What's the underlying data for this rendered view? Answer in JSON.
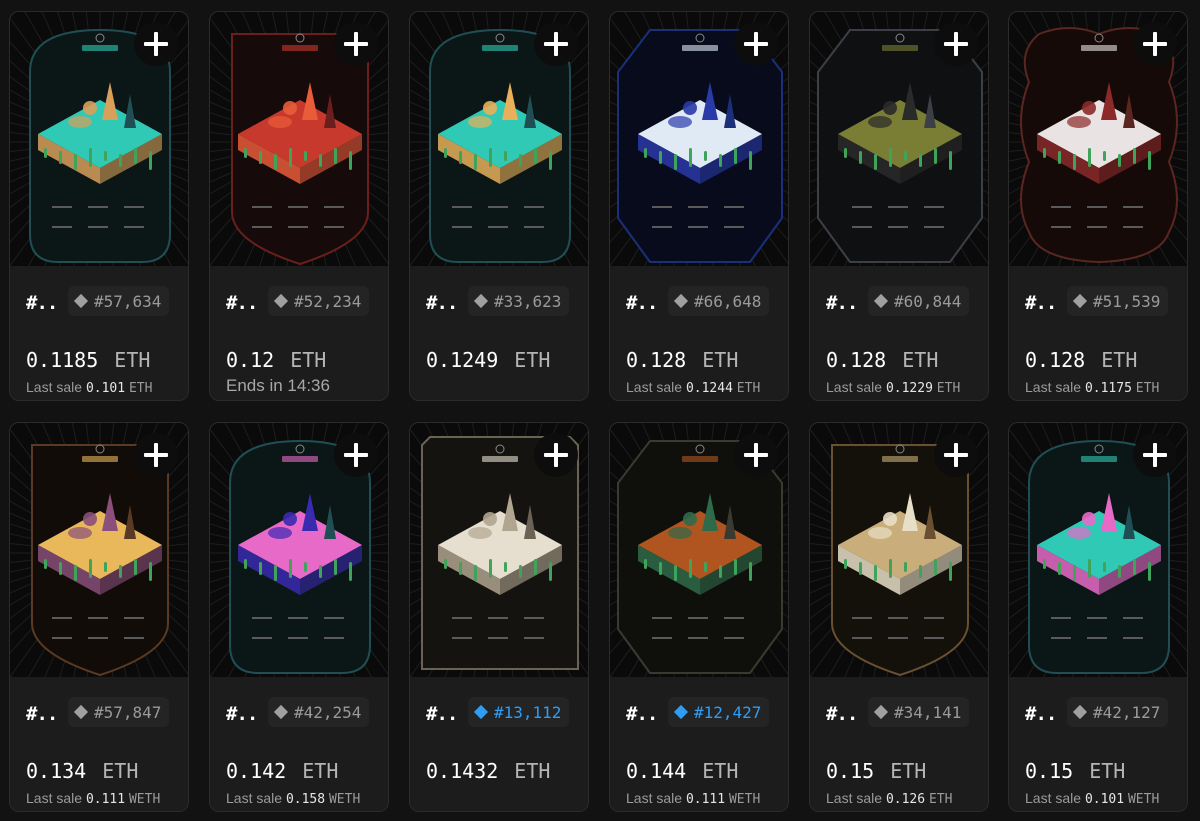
{
  "cards": [
    {
      "name": "#..",
      "rank": "#57,634",
      "rank_style": "common",
      "price": "0.1185",
      "currency": "ETH",
      "sub_label": "Last sale",
      "sub_value": "0.101",
      "sub_unit": "ETH",
      "frame_color": "#1f4f55",
      "bg_color": "#0b1616",
      "ground_color": "#2fc9b6",
      "accent_color": "#d9a05a",
      "frame": "round"
    },
    {
      "name": "#..",
      "rank": "#52,234",
      "rank_style": "common",
      "price": "0.12",
      "currency": "ETH",
      "sub_label": "Ends in 14:36",
      "sub_value": "",
      "sub_unit": "",
      "frame_color": "#6b1f1c",
      "bg_color": "#170a0a",
      "ground_color": "#c8392d",
      "accent_color": "#e85c3a",
      "frame": "shield"
    },
    {
      "name": "#..",
      "rank": "#33,623",
      "rank_style": "common",
      "price": "0.1249",
      "currency": "ETH",
      "sub_label": "",
      "sub_value": "",
      "sub_unit": "",
      "frame_color": "#1f4f55",
      "bg_color": "#0b1616",
      "ground_color": "#2fc9b6",
      "accent_color": "#e8b05a",
      "frame": "round"
    },
    {
      "name": "#..",
      "rank": "#66,648",
      "rank_style": "common",
      "price": "0.128",
      "currency": "ETH",
      "sub_label": "Last sale",
      "sub_value": "0.1244",
      "sub_unit": "ETH",
      "frame_color": "#1b2f7a",
      "bg_color": "#070b1c",
      "ground_color": "#dfeaf5",
      "accent_color": "#2a3aa8",
      "frame": "hex"
    },
    {
      "name": "#..",
      "rank": "#60,844",
      "rank_style": "common",
      "price": "0.128",
      "currency": "ETH",
      "sub_label": "Last sale",
      "sub_value": "0.1229",
      "sub_unit": "ETH",
      "frame_color": "#3c3f45",
      "bg_color": "#0f1012",
      "ground_color": "#7a7e35",
      "accent_color": "#2a2a2a",
      "frame": "hex"
    },
    {
      "name": "#..",
      "rank": "#51,539",
      "rank_style": "common",
      "price": "0.128",
      "currency": "ETH",
      "sub_label": "Last sale",
      "sub_value": "0.1175",
      "sub_unit": "ETH",
      "frame_color": "#5a2620",
      "bg_color": "#160a08",
      "ground_color": "#e9e3e3",
      "accent_color": "#8c2a2a",
      "frame": "wavy"
    },
    {
      "name": "#..",
      "rank": "#57,847",
      "rank_style": "common",
      "price": "0.134",
      "currency": "ETH",
      "sub_label": "Last sale",
      "sub_value": "0.111",
      "sub_unit": "WETH",
      "frame_color": "#5a3a22",
      "bg_color": "#120c08",
      "ground_color": "#e8b85a",
      "accent_color": "#8a4f7a",
      "frame": "shield"
    },
    {
      "name": "#..",
      "rank": "#42,254",
      "rank_style": "common",
      "price": "0.142",
      "currency": "ETH",
      "sub_label": "Last sale",
      "sub_value": "0.158",
      "sub_unit": "WETH",
      "frame_color": "#1f4f55",
      "bg_color": "#0b1616",
      "ground_color": "#e86ac8",
      "accent_color": "#3a2ab0",
      "frame": "round"
    },
    {
      "name": "#..",
      "rank": "#13,112",
      "rank_style": "rare",
      "price": "0.1432",
      "currency": "ETH",
      "sub_label": "",
      "sub_value": "",
      "sub_unit": "",
      "frame_color": "#6a6255",
      "bg_color": "#15130f",
      "ground_color": "#e6dfcf",
      "accent_color": "#b0a58f",
      "frame": "square"
    },
    {
      "name": "#..",
      "rank": "#12,427",
      "rank_style": "rare",
      "price": "0.144",
      "currency": "ETH",
      "sub_label": "Last sale",
      "sub_value": "0.111",
      "sub_unit": "WETH",
      "frame_color": "#3a3a30",
      "bg_color": "#0f0f0c",
      "ground_color": "#b0551f",
      "accent_color": "#2f6a4a",
      "frame": "hex"
    },
    {
      "name": "#..",
      "rank": "#34,141",
      "rank_style": "common",
      "price": "0.15",
      "currency": "ETH",
      "sub_label": "Last sale",
      "sub_value": "0.126",
      "sub_unit": "ETH",
      "frame_color": "#6a5030",
      "bg_color": "#14100a",
      "ground_color": "#c9ad7a",
      "accent_color": "#e8dfc8",
      "frame": "shield"
    },
    {
      "name": "#..",
      "rank": "#42,127",
      "rank_style": "common",
      "price": "0.15",
      "currency": "ETH",
      "sub_label": "Last sale",
      "sub_value": "0.101",
      "sub_unit": "WETH",
      "frame_color": "#1f4f55",
      "bg_color": "#0b1616",
      "ground_color": "#2fc9b6",
      "accent_color": "#e86ac8",
      "frame": "round"
    }
  ]
}
